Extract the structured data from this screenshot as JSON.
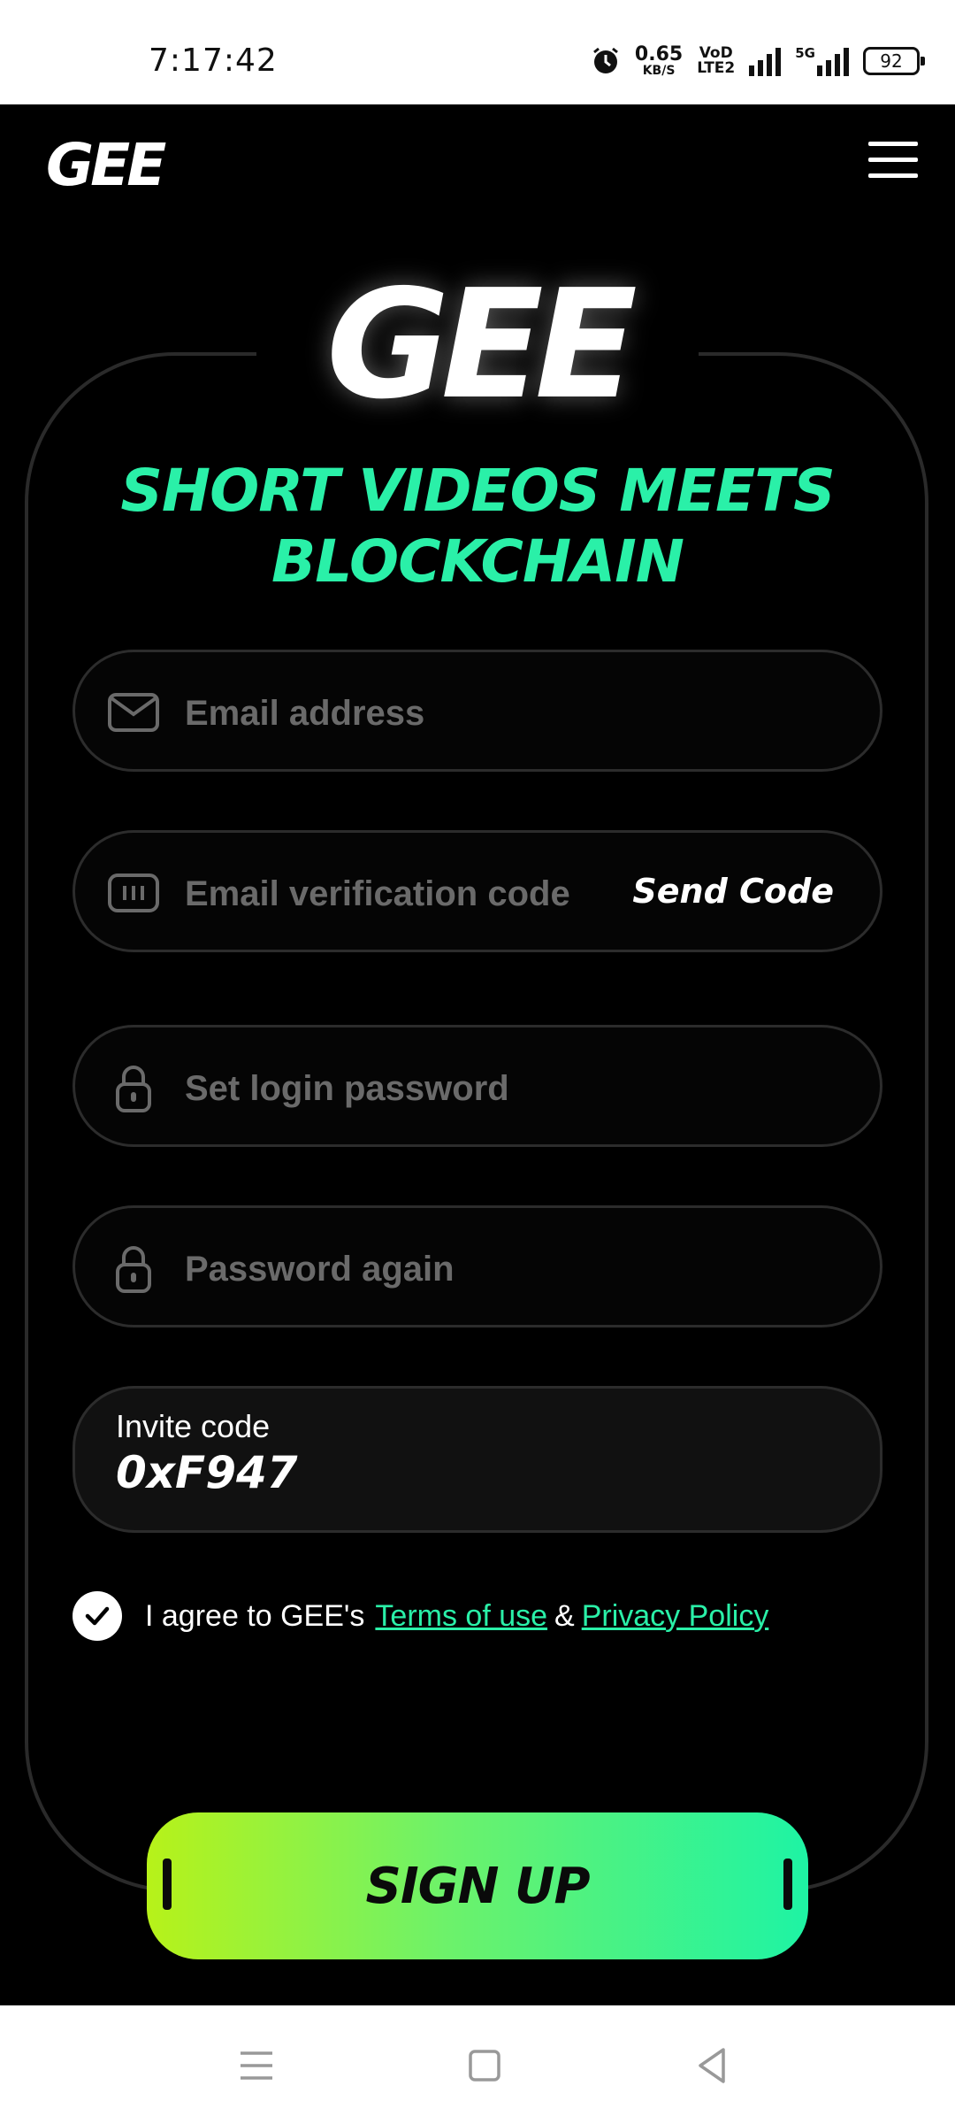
{
  "status_bar": {
    "time": "7:17:42",
    "net_speed": "0.65",
    "net_unit": "KB/S",
    "vod_top": "VoD",
    "vod_bottom": "LTE2",
    "fiveg": "5G",
    "battery": "92"
  },
  "header": {
    "logo": "GEE"
  },
  "hero": {
    "logo": "GEE",
    "headline": "SHORT VIDEOS MEETS BLOCKCHAIN"
  },
  "form": {
    "email_placeholder": "Email address",
    "code_placeholder": "Email verification code",
    "send_code_label": "Send Code",
    "password_placeholder": "Set login password",
    "password_again_placeholder": "Password again",
    "invite_label": "Invite code",
    "invite_value": "0xF947",
    "agree_text": "I agree to GEE's",
    "terms_label": "Terms of use",
    "amp": "&",
    "privacy_label": "Privacy Policy",
    "signup_label": "SIGN UP"
  },
  "colors": {
    "accent": "#2af0a8",
    "gradient_start": "#b7f219",
    "gradient_end": "#1ef3a4"
  }
}
